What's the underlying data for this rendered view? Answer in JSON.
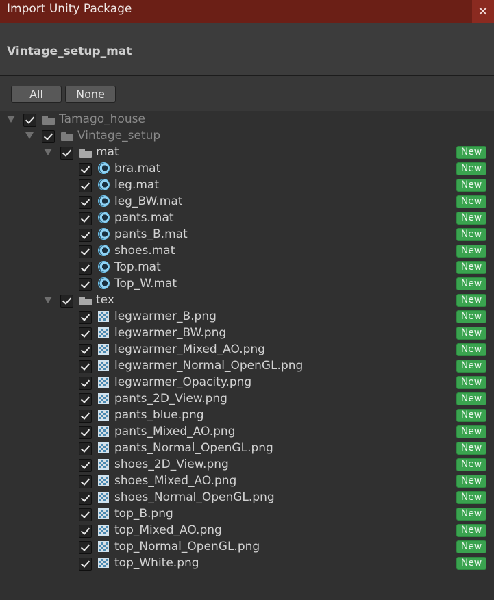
{
  "window": {
    "title": "Import Unity Package",
    "close_glyph": "✕"
  },
  "package": {
    "name": "Vintage_setup_mat"
  },
  "toolbar": {
    "all_label": "All",
    "none_label": "None"
  },
  "badge_label": "New",
  "colors": {
    "title_bar": "#6b1f16",
    "badge": "#3aa34f",
    "background": "#383838"
  },
  "tree": [
    {
      "label": "Tamago_house",
      "type": "folder",
      "depth": 0,
      "expanded": true,
      "checked": true,
      "dim": true,
      "is_new": false
    },
    {
      "label": "Vintage_setup",
      "type": "folder",
      "depth": 1,
      "expanded": true,
      "checked": true,
      "dim": true,
      "is_new": false
    },
    {
      "label": "mat",
      "type": "folder",
      "depth": 2,
      "expanded": true,
      "checked": true,
      "dim": false,
      "is_new": true
    },
    {
      "label": "bra.mat",
      "type": "material",
      "depth": 3,
      "checked": true,
      "is_new": true
    },
    {
      "label": "leg.mat",
      "type": "material",
      "depth": 3,
      "checked": true,
      "is_new": true
    },
    {
      "label": "leg_BW.mat",
      "type": "material",
      "depth": 3,
      "checked": true,
      "is_new": true
    },
    {
      "label": "pants.mat",
      "type": "material",
      "depth": 3,
      "checked": true,
      "is_new": true
    },
    {
      "label": "pants_B.mat",
      "type": "material",
      "depth": 3,
      "checked": true,
      "is_new": true
    },
    {
      "label": "shoes.mat",
      "type": "material",
      "depth": 3,
      "checked": true,
      "is_new": true
    },
    {
      "label": "Top.mat",
      "type": "material",
      "depth": 3,
      "checked": true,
      "is_new": true
    },
    {
      "label": "Top_W.mat",
      "type": "material",
      "depth": 3,
      "checked": true,
      "is_new": true
    },
    {
      "label": "tex",
      "type": "folder",
      "depth": 2,
      "expanded": true,
      "checked": true,
      "dim": false,
      "is_new": true
    },
    {
      "label": "legwarmer_B.png",
      "type": "texture",
      "depth": 3,
      "checked": true,
      "is_new": true
    },
    {
      "label": "legwarmer_BW.png",
      "type": "texture",
      "depth": 3,
      "checked": true,
      "is_new": true
    },
    {
      "label": "legwarmer_Mixed_AO.png",
      "type": "texture",
      "depth": 3,
      "checked": true,
      "is_new": true
    },
    {
      "label": "legwarmer_Normal_OpenGL.png",
      "type": "texture",
      "depth": 3,
      "checked": true,
      "is_new": true
    },
    {
      "label": "legwarmer_Opacity.png",
      "type": "texture",
      "depth": 3,
      "checked": true,
      "is_new": true
    },
    {
      "label": "pants_2D_View.png",
      "type": "texture",
      "depth": 3,
      "checked": true,
      "is_new": true
    },
    {
      "label": "pants_blue.png",
      "type": "texture",
      "depth": 3,
      "checked": true,
      "is_new": true
    },
    {
      "label": "pants_Mixed_AO.png",
      "type": "texture",
      "depth": 3,
      "checked": true,
      "is_new": true
    },
    {
      "label": "pants_Normal_OpenGL.png",
      "type": "texture",
      "depth": 3,
      "checked": true,
      "is_new": true
    },
    {
      "label": "shoes_2D_View.png",
      "type": "texture",
      "depth": 3,
      "checked": true,
      "is_new": true
    },
    {
      "label": "shoes_Mixed_AO.png",
      "type": "texture",
      "depth": 3,
      "checked": true,
      "is_new": true
    },
    {
      "label": "shoes_Normal_OpenGL.png",
      "type": "texture",
      "depth": 3,
      "checked": true,
      "is_new": true
    },
    {
      "label": "top_B.png",
      "type": "texture",
      "depth": 3,
      "checked": true,
      "is_new": true
    },
    {
      "label": "top_Mixed_AO.png",
      "type": "texture",
      "depth": 3,
      "checked": true,
      "is_new": true
    },
    {
      "label": "top_Normal_OpenGL.png",
      "type": "texture",
      "depth": 3,
      "checked": true,
      "is_new": true
    },
    {
      "label": "top_White.png",
      "type": "texture",
      "depth": 3,
      "checked": true,
      "is_new": true
    }
  ]
}
